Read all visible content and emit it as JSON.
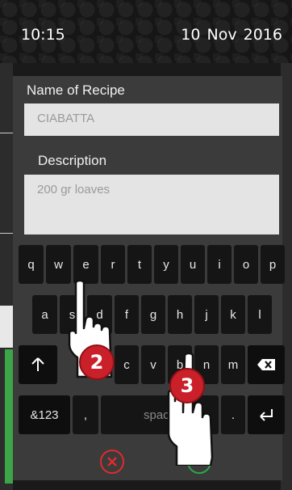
{
  "status_bar": {
    "time": "10:15",
    "date": "10  Nov  2016"
  },
  "dialog": {
    "name_label": "Name of Recipe",
    "name_value": "CIABATTA",
    "description_label": "Description",
    "description_value": "200 gr loaves"
  },
  "keyboard": {
    "row1": [
      "q",
      "w",
      "e",
      "r",
      "t",
      "y",
      "u",
      "i",
      "o",
      "p"
    ],
    "row2": [
      "a",
      "s",
      "d",
      "f",
      "g",
      "h",
      "j",
      "k",
      "l"
    ],
    "row3": [
      "c",
      "v",
      "b",
      "n",
      "m"
    ],
    "shift_icon": "shift-arrow-icon",
    "backspace_icon": "backspace-icon",
    "numbers_label": "&123",
    "comma_label": ",",
    "space_label": "space",
    "period_label": ".",
    "enter_icon": "enter-icon"
  },
  "actions": {
    "cancel_icon": "cancel-x-icon",
    "confirm_icon": "confirm-check-icon"
  },
  "tutorial": {
    "step_2": "2",
    "step_3": "3",
    "hand_icon": "pointing-hand-icon",
    "badge_color": "#c9202a"
  },
  "colors": {
    "cancel": "#e02b2b",
    "confirm": "#2ba84a",
    "side_green": "#3ca548"
  }
}
